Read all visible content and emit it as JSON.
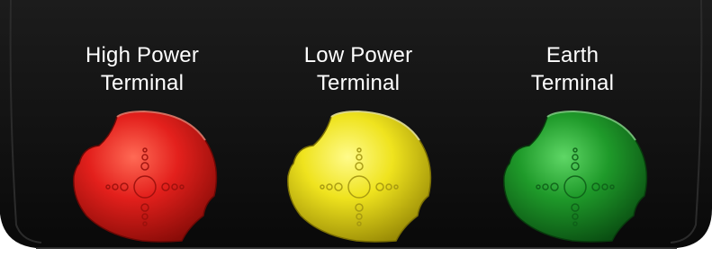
{
  "terminals": [
    {
      "id": "high-power",
      "label_line1": "High Power",
      "label_line2": "Terminal",
      "color": "#e3201c",
      "highlight": "#ff6a55",
      "shadow": "#8a0c08"
    },
    {
      "id": "low-power",
      "label_line1": "Low Power",
      "label_line2": "Terminal",
      "color": "#efe31e",
      "highlight": "#fffb8a",
      "shadow": "#9a8c06"
    },
    {
      "id": "earth",
      "label_line1": "Earth",
      "label_line2": "Terminal",
      "color": "#1f9a2a",
      "highlight": "#5fd766",
      "shadow": "#0a4f12"
    }
  ],
  "panel": {
    "background_color": "#121212",
    "edge_color": "#2a2a2a"
  },
  "icons": {
    "knob_pattern": "cross-dots-icon"
  }
}
